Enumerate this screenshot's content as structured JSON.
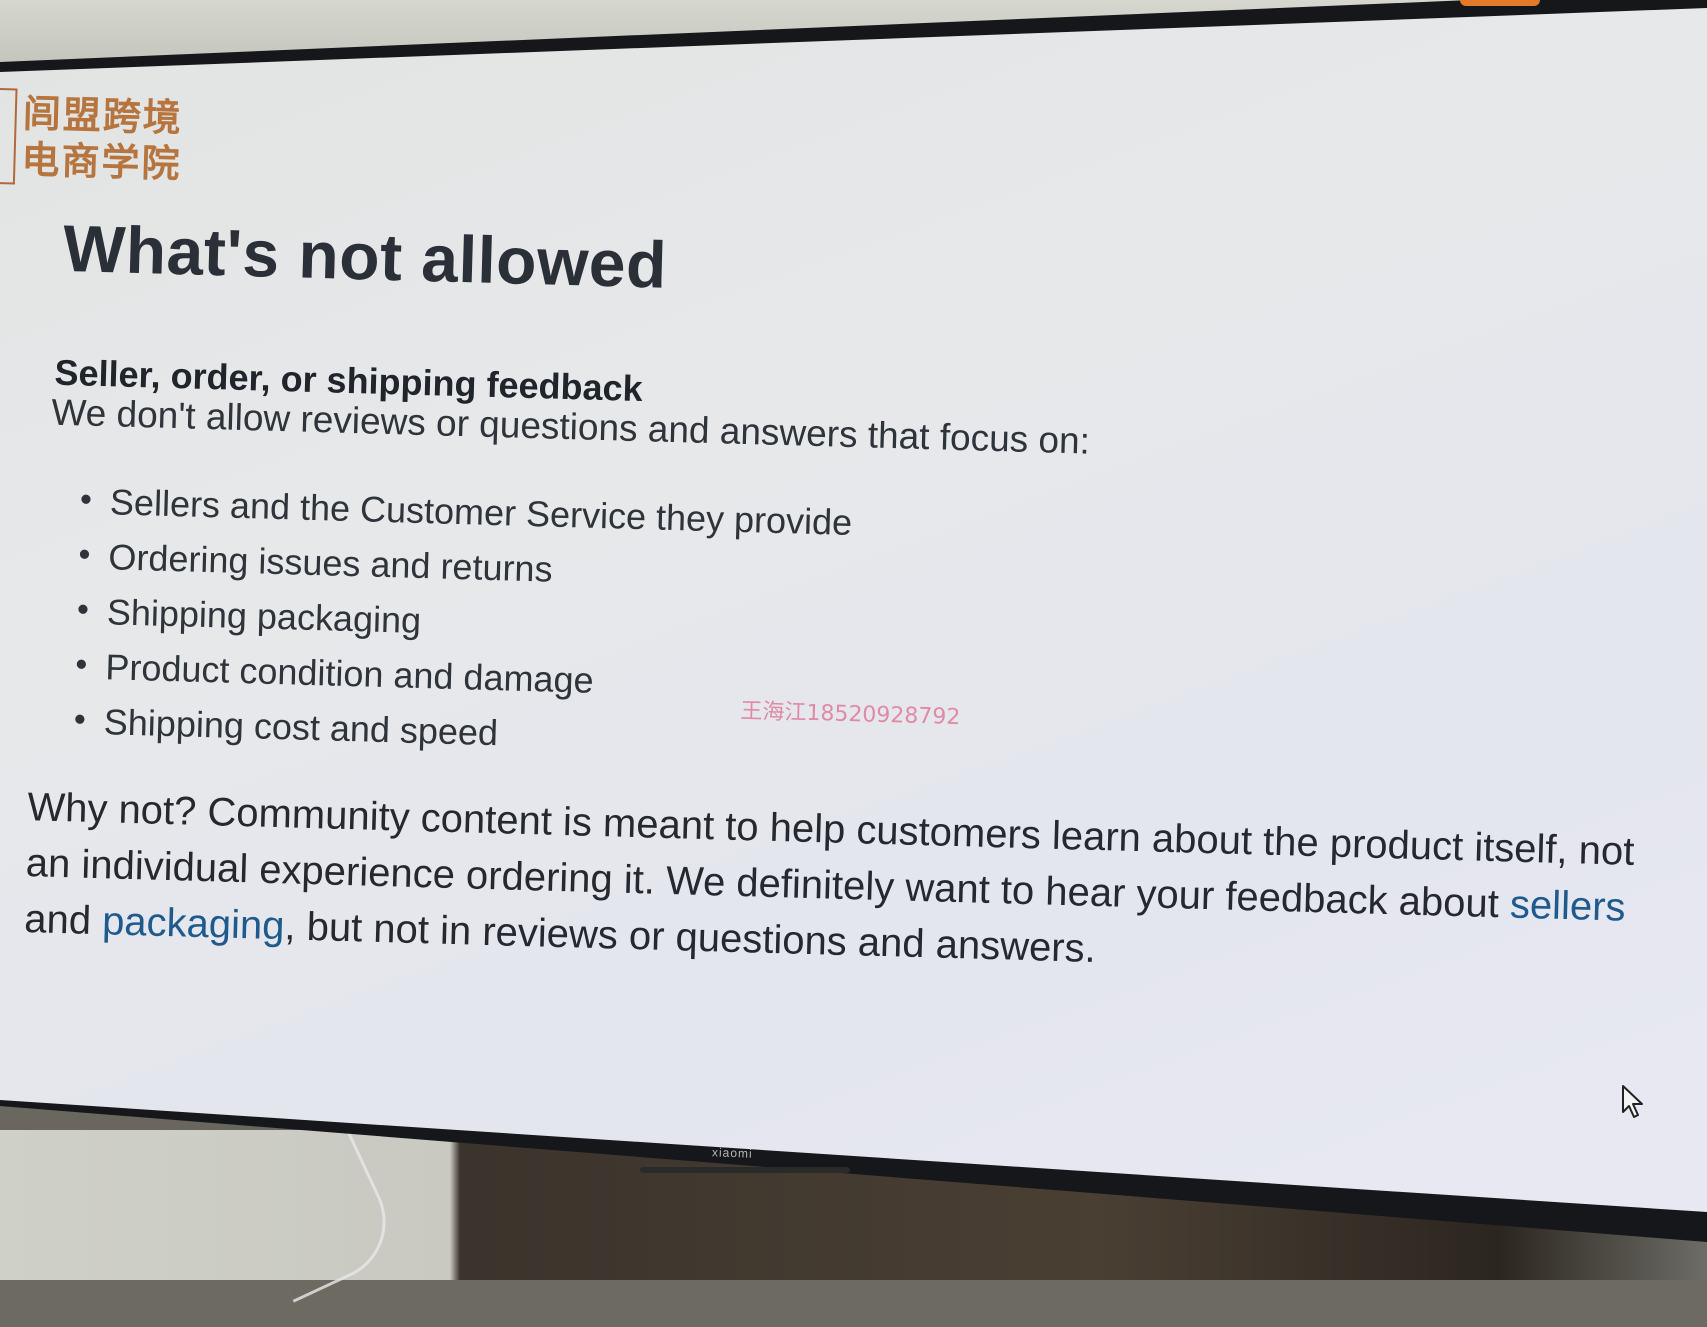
{
  "logo": {
    "line1": "闾盟跨境",
    "line2": "电商学院"
  },
  "slide": {
    "title": "What's not allowed",
    "subhead": "Seller, order, or shipping feedback",
    "intro": "We don't allow reviews or questions and answers that focus on:",
    "bullets": [
      "Sellers and the Customer Service they provide",
      "Ordering issues and returns",
      "Shipping packaging",
      "Product condition and damage",
      "Shipping cost and speed"
    ],
    "why": {
      "part1": "Why not? Community content is meant to help customers learn about the product itself, not an individual experience ordering it. We definitely want to hear your feedback about ",
      "link1": "sellers",
      "part2": " and ",
      "link2": "packaging",
      "part3": ", but not in reviews or questions and answers."
    }
  },
  "watermark": "王海江18520928792",
  "monitor": {
    "brand": "xiaomi"
  },
  "colors": {
    "title": "#2b2f37",
    "link": "#1f5a8c",
    "logo": "#b6753f",
    "watermark": "#e07a9a"
  },
  "icons": {
    "cursor": "mouse-pointer-icon"
  }
}
